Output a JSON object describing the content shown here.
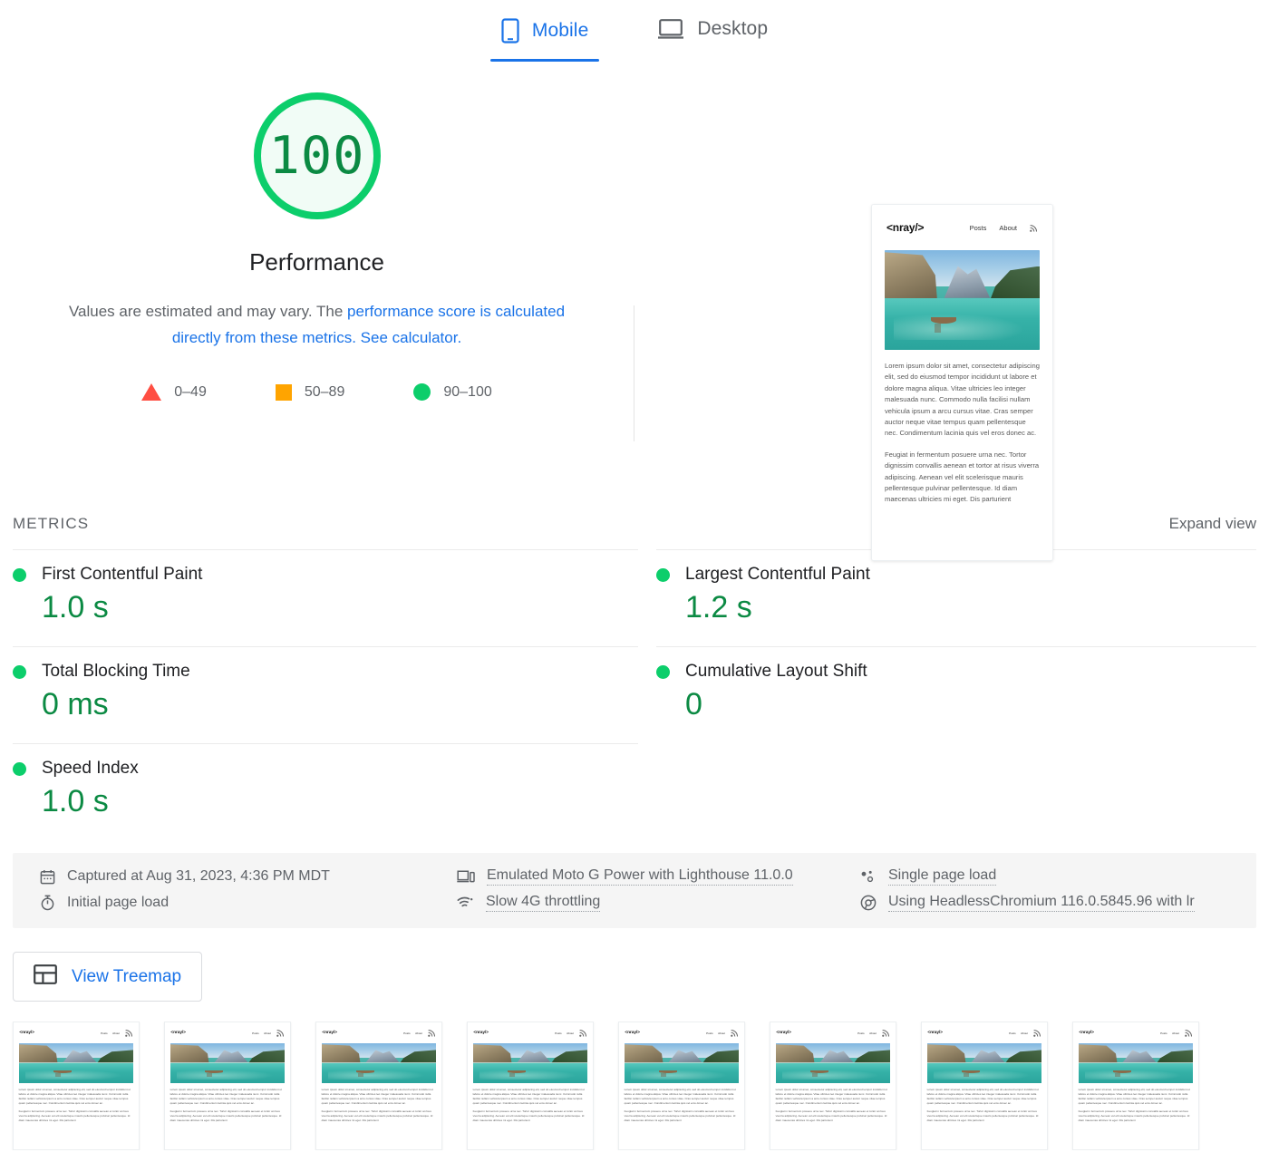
{
  "tabs": [
    {
      "label": "Mobile",
      "icon": "mobile-phone-icon",
      "active": true
    },
    {
      "label": "Desktop",
      "icon": "laptop-icon",
      "active": false
    }
  ],
  "score": {
    "value": "100",
    "title": "Performance",
    "color": "#0cce6b",
    "desc_prefix": "Values are estimated and may vary. The ",
    "desc_link1": "performance score is calculated directly from these metrics.",
    "desc_link2": "See calculator.",
    "legend": [
      {
        "shape": "triangle",
        "color": "#ff4e42",
        "label": "0–49"
      },
      {
        "shape": "square",
        "color": "#ffa400",
        "label": "50–89"
      },
      {
        "shape": "circle",
        "color": "#0cce6b",
        "label": "90–100"
      }
    ]
  },
  "preview": {
    "logo": "<nray/>",
    "nav": [
      "Posts",
      "About"
    ],
    "rss_icon": "rss-icon",
    "paragraphs": [
      "Lorem ipsum dolor sit amet, consectetur adipiscing elit, sed do eiusmod tempor incididunt ut labore et dolore magna aliqua. Vitae ultricies leo integer malesuada nunc. Commodo nulla facilisi nullam vehicula ipsum a arcu cursus vitae. Cras semper auctor neque vitae tempus quam pellentesque nec. Condimentum lacinia quis vel eros donec ac.",
      "Feugiat in fermentum posuere urna nec. Tortor dignissim convallis aenean et tortor at risus viverra adipiscing. Aenean vel elit scelerisque mauris pellentesque pulvinar pellentesque. Id diam maecenas ultricies mi eget. Dis parturient"
    ]
  },
  "metrics": {
    "section_title": "METRICS",
    "expand_view": "Expand view",
    "left": [
      {
        "name": "First Contentful Paint",
        "value": "1.0 s",
        "status": "pass"
      },
      {
        "name": "Total Blocking Time",
        "value": "0 ms",
        "status": "pass"
      },
      {
        "name": "Speed Index",
        "value": "1.0 s",
        "status": "pass"
      }
    ],
    "right": [
      {
        "name": "Largest Contentful Paint",
        "value": "1.2 s",
        "status": "pass"
      },
      {
        "name": "Cumulative Layout Shift",
        "value": "0",
        "status": "pass"
      }
    ]
  },
  "environment": [
    {
      "icon": "calendar-icon",
      "text": "Captured at Aug 31, 2023, 4:36 PM MDT",
      "dotted": false
    },
    {
      "icon": "device-icon",
      "text": "Emulated Moto G Power with Lighthouse 11.0.0",
      "dotted": true
    },
    {
      "icon": "users-icon",
      "text": "Single page load",
      "dotted": true
    },
    {
      "icon": "stopwatch-icon",
      "text": "Initial page load",
      "dotted": false
    },
    {
      "icon": "network-icon",
      "text": "Slow 4G throttling",
      "dotted": true
    },
    {
      "icon": "chrome-icon",
      "text": "Using HeadlessChromium 116.0.5845.96 with lr",
      "dotted": true
    }
  ],
  "treemap": {
    "label": "View Treemap",
    "icon": "treemap-icon"
  },
  "filmstrip": {
    "count": 8
  }
}
